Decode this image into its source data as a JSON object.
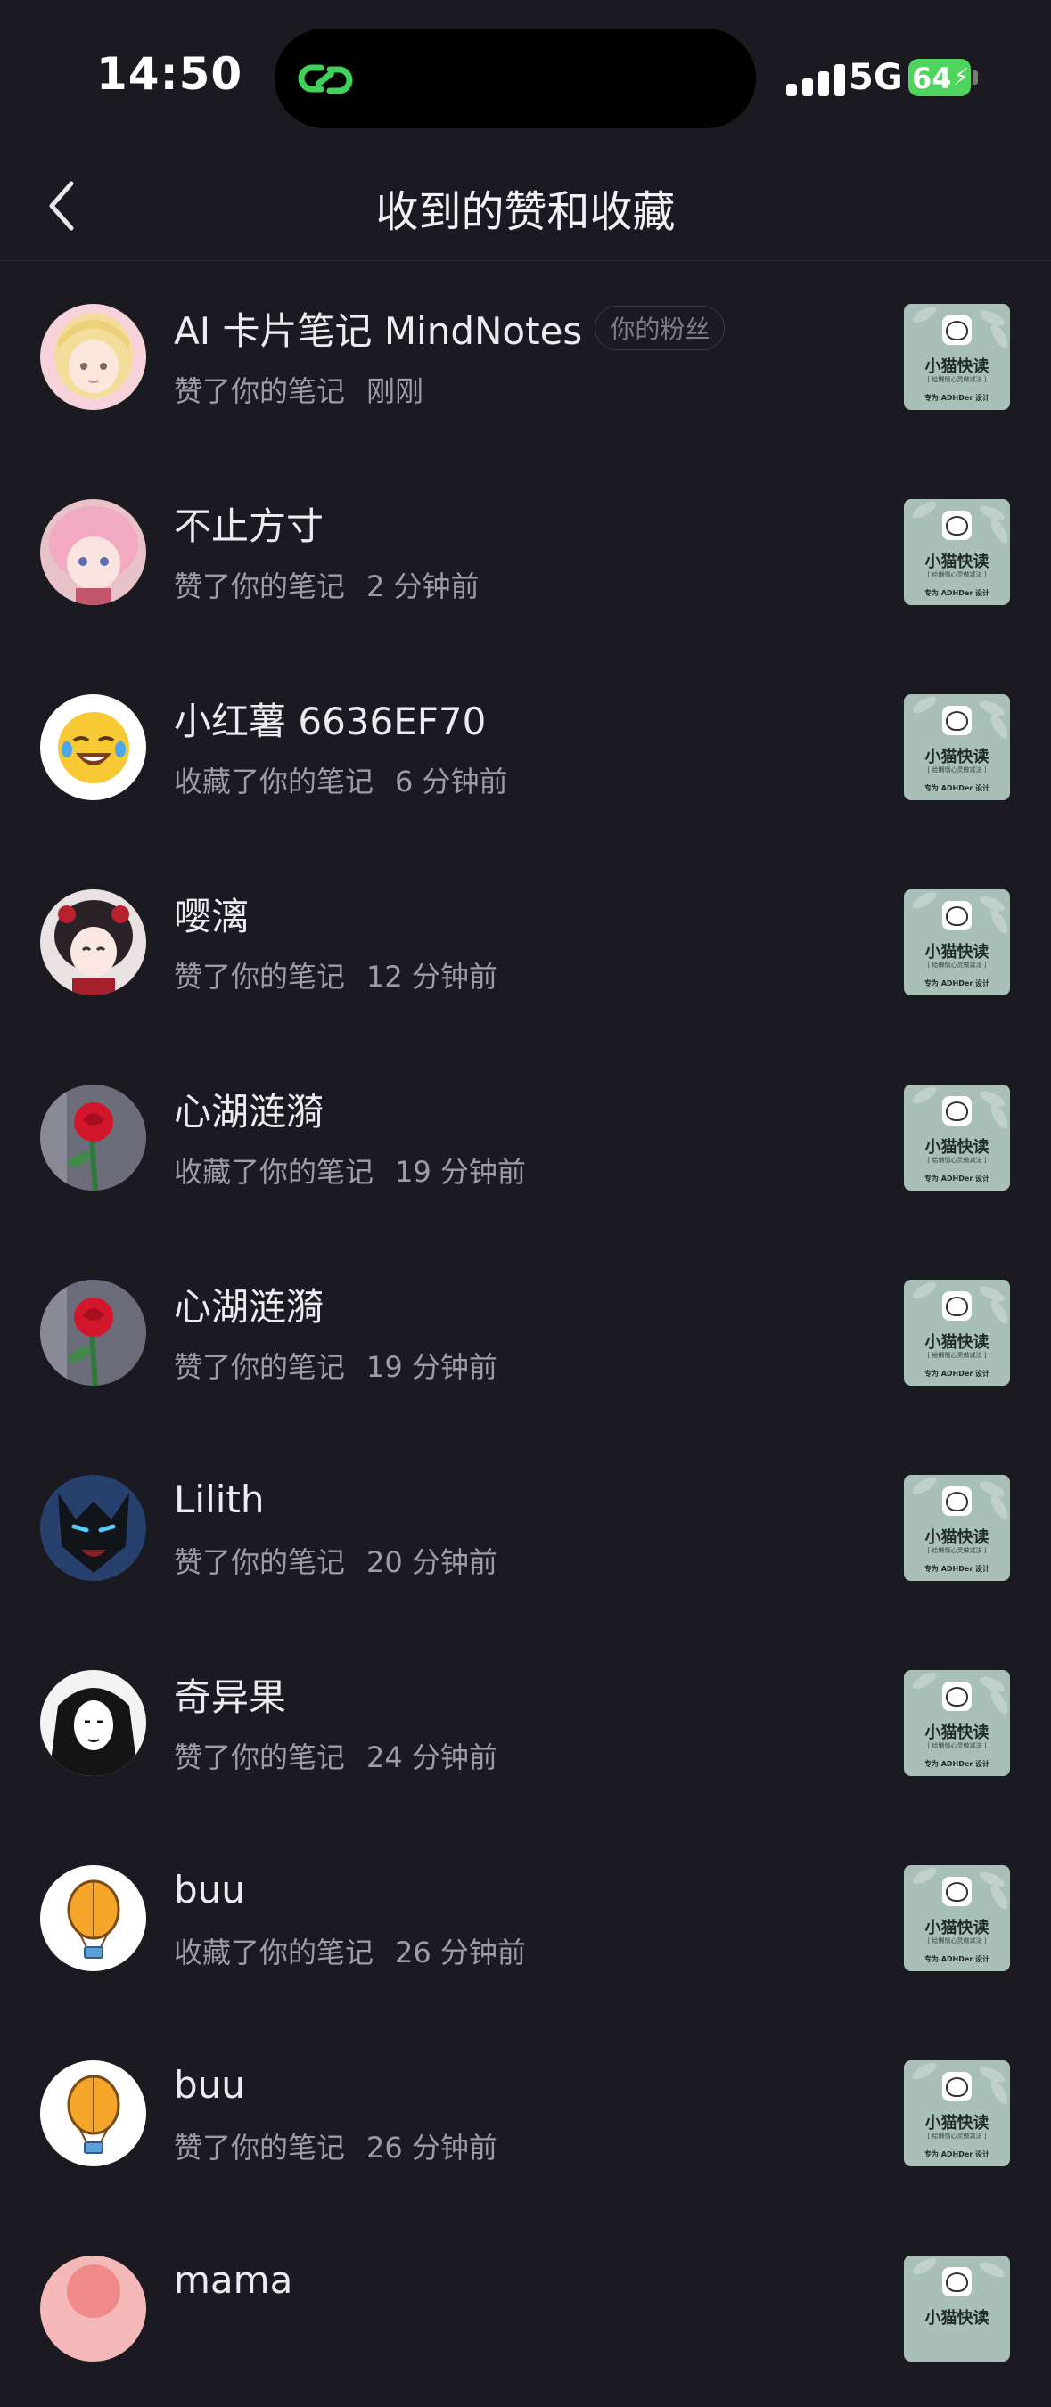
{
  "status_bar": {
    "time": "14:50",
    "network": "5G",
    "battery": "64"
  },
  "header": {
    "title": "收到的赞和收藏"
  },
  "items": [
    {
      "name": "AI 卡片笔记 MindNotes",
      "badge": "你的粉丝",
      "action": "赞了你的笔记",
      "time": "刚刚",
      "avatar": "anime-blonde-girl"
    },
    {
      "name": "不止方寸",
      "action": "赞了你的笔记",
      "time": "2 分钟前",
      "avatar": "anime-pink-hair"
    },
    {
      "name": "小红薯 6636EF70",
      "action": "收藏了你的笔记",
      "time": "6 分钟前",
      "avatar": "laughing-emoji"
    },
    {
      "name": "嘤漓",
      "action": "赞了你的笔记",
      "time": "12 分钟前",
      "avatar": "anime-dark-hair"
    },
    {
      "name": "心湖涟漪",
      "action": "收藏了你的笔记",
      "time": "19 分钟前",
      "avatar": "red-rose"
    },
    {
      "name": "心湖涟漪",
      "action": "赞了你的笔记",
      "time": "19 分钟前",
      "avatar": "red-rose"
    },
    {
      "name": "Lilith",
      "action": "赞了你的笔记",
      "time": "20 分钟前",
      "avatar": "dark-wolf"
    },
    {
      "name": "奇异果",
      "action": "赞了你的笔记",
      "time": "24 分钟前",
      "avatar": "bw-girl"
    },
    {
      "name": "buu",
      "action": "收藏了你的笔记",
      "time": "26 分钟前",
      "avatar": "hot-air-balloon"
    },
    {
      "name": "buu",
      "action": "赞了你的笔记",
      "time": "26 分钟前",
      "avatar": "hot-air-balloon"
    },
    {
      "name": "mama",
      "action": "",
      "time": "",
      "avatar": "pink-avatar"
    }
  ],
  "note_thumb": {
    "title": "小猫快读",
    "subtitle": "[ 给懒惰心灵做减法 ]",
    "footer": "专为 ADHDer 设计"
  }
}
